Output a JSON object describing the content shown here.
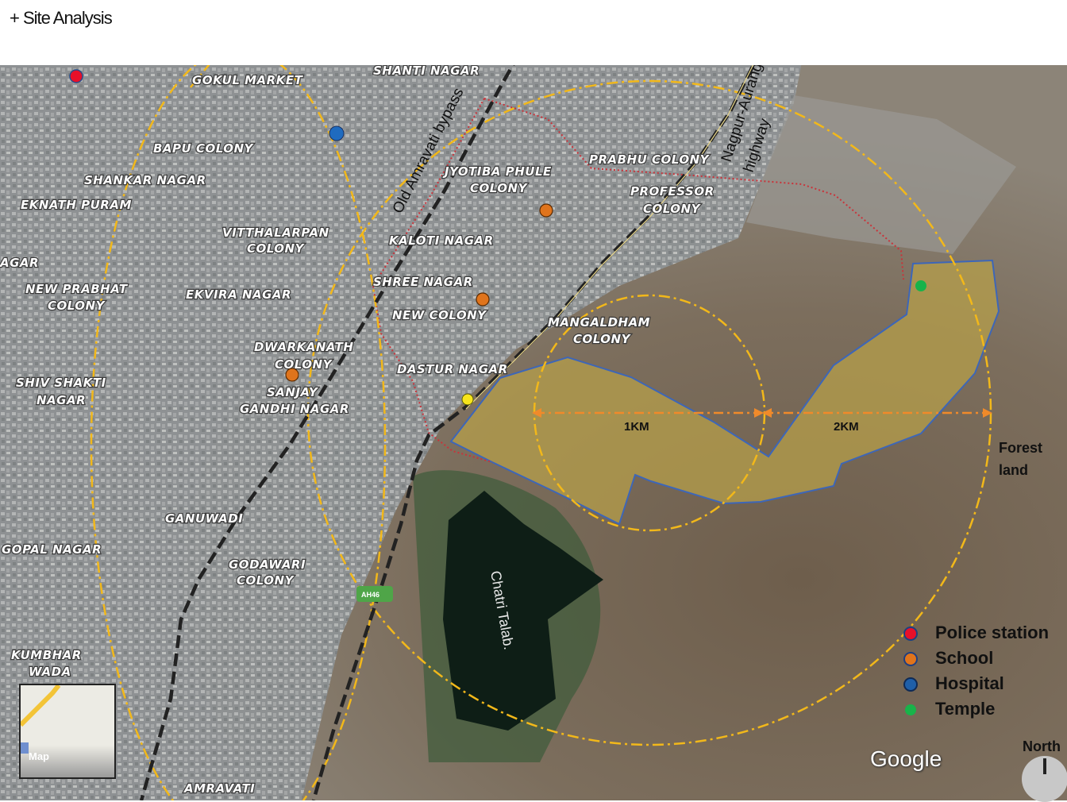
{
  "header": {
    "title": "+ Site Analysis"
  },
  "places": [
    "GOKUL MARKET",
    "SHANTI NAGAR",
    "BAPU COLONY",
    "SHANKAR NAGAR",
    "EKNATH PURAM",
    "JYOTIBA PHULE",
    "COLONY",
    "PRABHU COLONY",
    "PROFESSOR",
    "COLONY",
    "VITTHALARPAN",
    "COLONY",
    "KALOTI NAGAR",
    "AGAR",
    "NEW PRABHAT",
    "COLONY",
    "EKVIRA NAGAR",
    "SHREE NAGAR",
    "NEW COLONY",
    "MANGALDHAM",
    "COLONY",
    "DWARKANATH",
    "COLONY",
    "DASTUR NAGAR",
    "SHIV SHAKTI",
    "NAGAR",
    "SANJAY",
    "GANDHI NAGAR",
    "GANUWADI",
    "GOPAL NAGAR",
    "GODAWARI",
    "COLONY",
    "KUMBHAR",
    "WADA",
    "AMRAVATI"
  ],
  "roads": {
    "old_amravati": "Old Amravati bypass",
    "nagpur_1": "Nagpur-Aurangabad",
    "nagpur_2": "highway",
    "nh_badge": "AH46"
  },
  "distances": {
    "d1": "1KM",
    "d2": "2KM"
  },
  "forest": {
    "line1": "Forest",
    "line2": "land"
  },
  "water": {
    "name": "Chatri Talab."
  },
  "legend": [
    {
      "label": "Police station",
      "color": "#e8102a"
    },
    {
      "label": "School",
      "color": "#e0741c"
    },
    {
      "label": "Hospital",
      "color": "#1f5fa8"
    },
    {
      "label": "Temple",
      "color": "#18b34a"
    }
  ],
  "minimap": {
    "label": "Map"
  },
  "attribution": "Google",
  "north": "North"
}
